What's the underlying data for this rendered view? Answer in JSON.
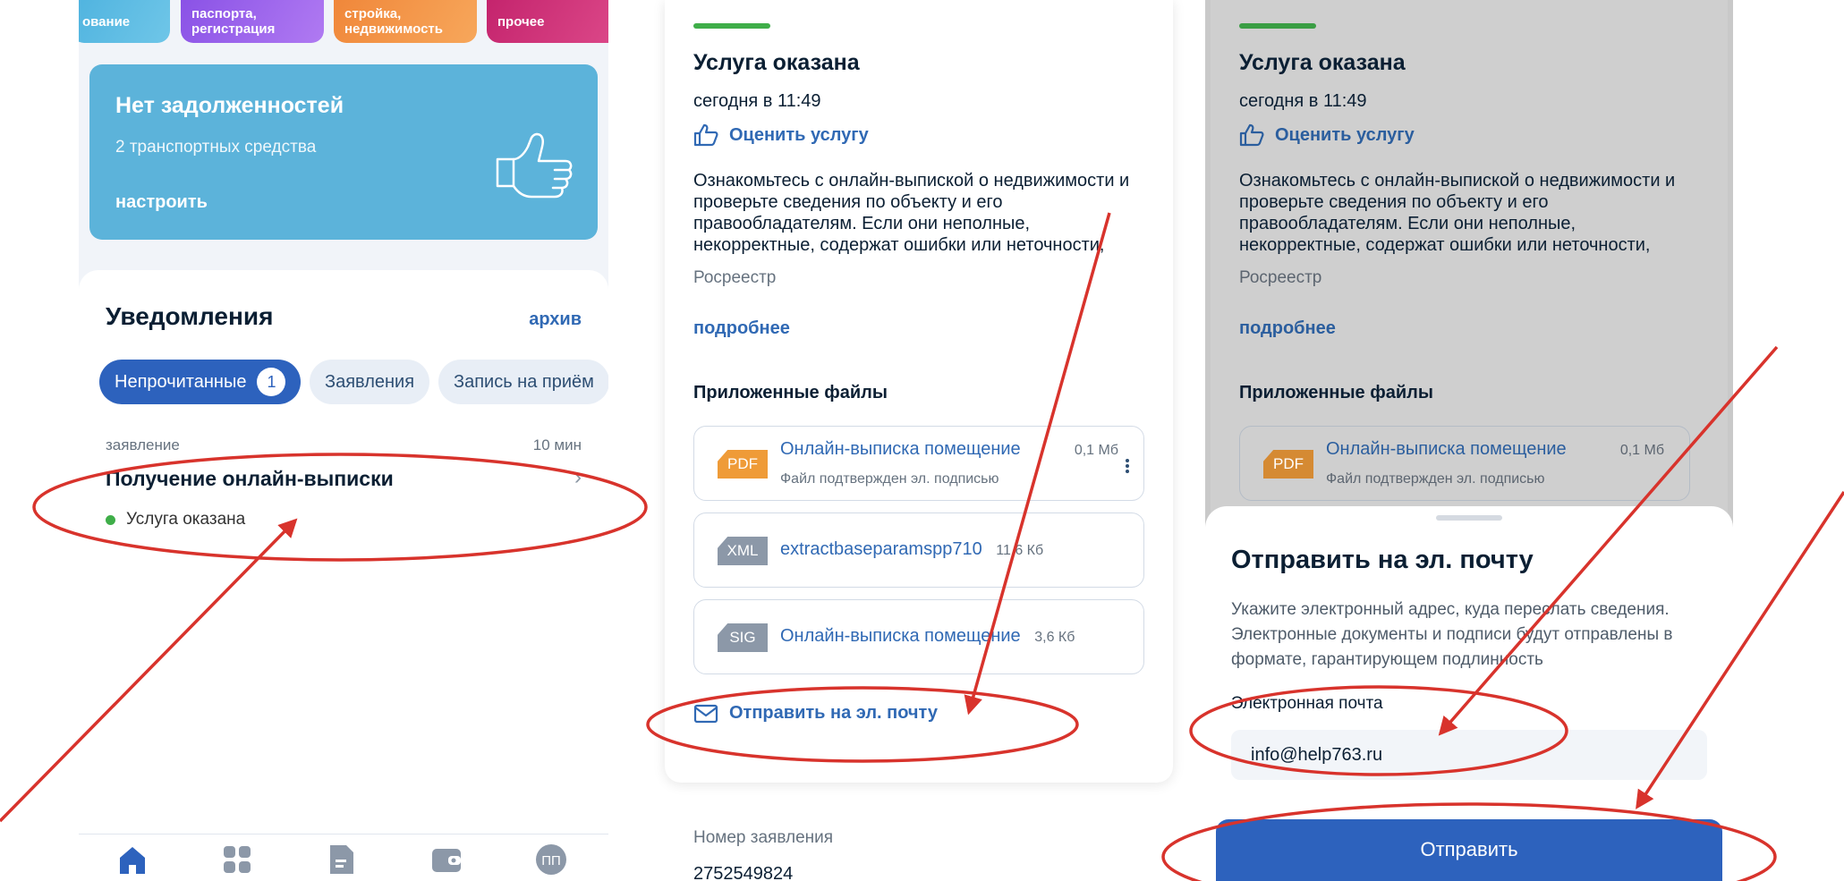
{
  "colors": {
    "brand_blue": "#2d62bd",
    "link_blue": "#3069b4",
    "status_green": "#3fae49",
    "annotation_red": "#d8332c",
    "pdf_orange": "#ef9b38"
  },
  "panel1": {
    "categories": [
      {
        "label": "ование",
        "color": "#5bbbe3"
      },
      {
        "label": "паспорта, регистрация",
        "color": "#9a62ea"
      },
      {
        "label": "стройка, недвижимость",
        "color": "#f38f42"
      },
      {
        "label": "прочее",
        "color": "#cc2f74"
      }
    ],
    "debt_card": {
      "title": "Нет задолженностей",
      "subtitle": "2 транспортных средства",
      "link": "настроить",
      "icon": "thumbs-up-icon"
    },
    "notifications": {
      "title": "Уведомления",
      "archive_link": "архив",
      "chips": [
        {
          "label": "Непрочитанные",
          "badge": "1",
          "active": true
        },
        {
          "label": "Заявления"
        },
        {
          "label": "Запись на приём"
        }
      ],
      "item": {
        "category": "заявление",
        "time": "10 мин",
        "title": "Получение онлайн-выписки",
        "status": "Услуга оказана"
      }
    },
    "tabbar": {
      "icons": [
        "home-icon",
        "grid-icon",
        "document-icon",
        "wallet-icon",
        "profile-icon"
      ],
      "profile_initials": "ПП"
    }
  },
  "panel2": {
    "status_title": "Услуга оказана",
    "time": "сегодня в 11:49",
    "rate_link": "Оценить услугу",
    "body": "Ознакомьтесь с онлайн-выпиской о недвижимости и проверьте сведения по объекту и его правообладателям. Если они неполные, некорректные, содержат ошибки или неточности,",
    "source": "Росреестр",
    "more_link": "подробнее",
    "files_heading": "Приложенные файлы",
    "files": [
      {
        "type": "PDF",
        "name": "Онлайн-выписка помещение",
        "size": "0,1 Мб",
        "sub": "Файл подтвержден эл. подписью"
      },
      {
        "type": "XML",
        "name": "extractbaseparamspp710",
        "size": "11,6 Кб"
      },
      {
        "type": "SIG",
        "name": "Онлайн-выписка помещение",
        "size": "3,6 Кб"
      }
    ],
    "send_link": "Отправить на эл. почту",
    "application_number_label": "Номер заявления",
    "application_number": "2752549824"
  },
  "panel3": {
    "status_title": "Услуга оказана",
    "time": "сегодня в 11:49",
    "rate_link": "Оценить услугу",
    "body": "Ознакомьтесь с онлайн-выпиской о недвижимости и проверьте сведения по объекту и его правообладателям. Если они неполные, некорректные, содержат ошибки или неточности,",
    "source": "Росреестр",
    "more_link": "подробнее",
    "files_heading": "Приложенные файлы",
    "file": {
      "type": "PDF",
      "name": "Онлайн-выписка помещение",
      "size": "0,1 Мб",
      "sub": "Файл подтвержден эл. подписью"
    },
    "sheet": {
      "title": "Отправить на эл. почту",
      "description": "Укажите электронный адрес, куда переслать сведения. Электронные документы и подписи будут отправлены в формате, гарантирующем подлинность",
      "email_label": "Электронная почта",
      "email_value": "info@help763.ru",
      "submit_label": "Отправить"
    }
  }
}
